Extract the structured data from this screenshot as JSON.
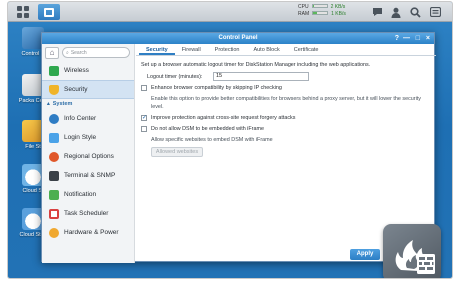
{
  "taskbar": {
    "resource_monitor": {
      "cpu_label": "CPU",
      "cpu_value": "0%",
      "ram_label": "RAM",
      "ram_value": "31%",
      "upload": "2 KB/s",
      "download": "1 KB/s"
    }
  },
  "desktop": {
    "icons": [
      {
        "label": "Control P"
      },
      {
        "label": "Packa Cent"
      },
      {
        "label": "File St"
      },
      {
        "label": "Cloud St"
      },
      {
        "label": "Cloud Stati"
      }
    ]
  },
  "window": {
    "title": "Control Panel",
    "controls": {
      "help": "?",
      "minimize": "—",
      "maximize": "□",
      "close": "×"
    }
  },
  "sidebar": {
    "search_placeholder": "Search",
    "items_top": [
      {
        "label": "Wireless",
        "icon": "wireless-icon",
        "color": "#2fa84f"
      },
      {
        "label": "Security",
        "icon": "shield-icon",
        "color": "#f0b429",
        "active": true
      }
    ],
    "section_label": "System",
    "items": [
      {
        "label": "Info Center",
        "icon": "info-icon",
        "color": "#2e7cc4"
      },
      {
        "label": "Login Style",
        "icon": "login-style-icon",
        "color": "#4aa2e8"
      },
      {
        "label": "Regional Options",
        "icon": "regional-icon",
        "color": "#e0572a"
      },
      {
        "label": "Terminal & SNMP",
        "icon": "terminal-icon",
        "color": "#3a4148"
      },
      {
        "label": "Notification",
        "icon": "notification-icon",
        "color": "#4caf50"
      },
      {
        "label": "Task Scheduler",
        "icon": "task-scheduler-icon",
        "color": "#d94040"
      },
      {
        "label": "Hardware & Power",
        "icon": "hardware-icon",
        "color": "#f0a830"
      }
    ]
  },
  "tabs": [
    {
      "label": "Security",
      "active": true
    },
    {
      "label": "Firewall"
    },
    {
      "label": "Protection"
    },
    {
      "label": "Auto Block"
    },
    {
      "label": "Certificate"
    }
  ],
  "security": {
    "intro": "Set up a browser automatic logout timer for DiskStation Manager including the web applications.",
    "logout_label": "Logout timer (minutes):",
    "logout_value": "15",
    "ip_check_label": "Enhance browser compatibility by skipping IP checking",
    "ip_check_note": "Enable this option to provide better compatibilities for browsers behind a proxy server, but it will lower the security level.",
    "csrf_label": "Improve protection against cross-site request forgery attacks",
    "csrf_checked": true,
    "iframe_label": "Do not allow DSM to be embedded with iFrame",
    "iframe_note": "Allow specific websites to embed DSM with iFrame",
    "allowed_button": "Allowed websites",
    "apply_button": "Apply"
  }
}
